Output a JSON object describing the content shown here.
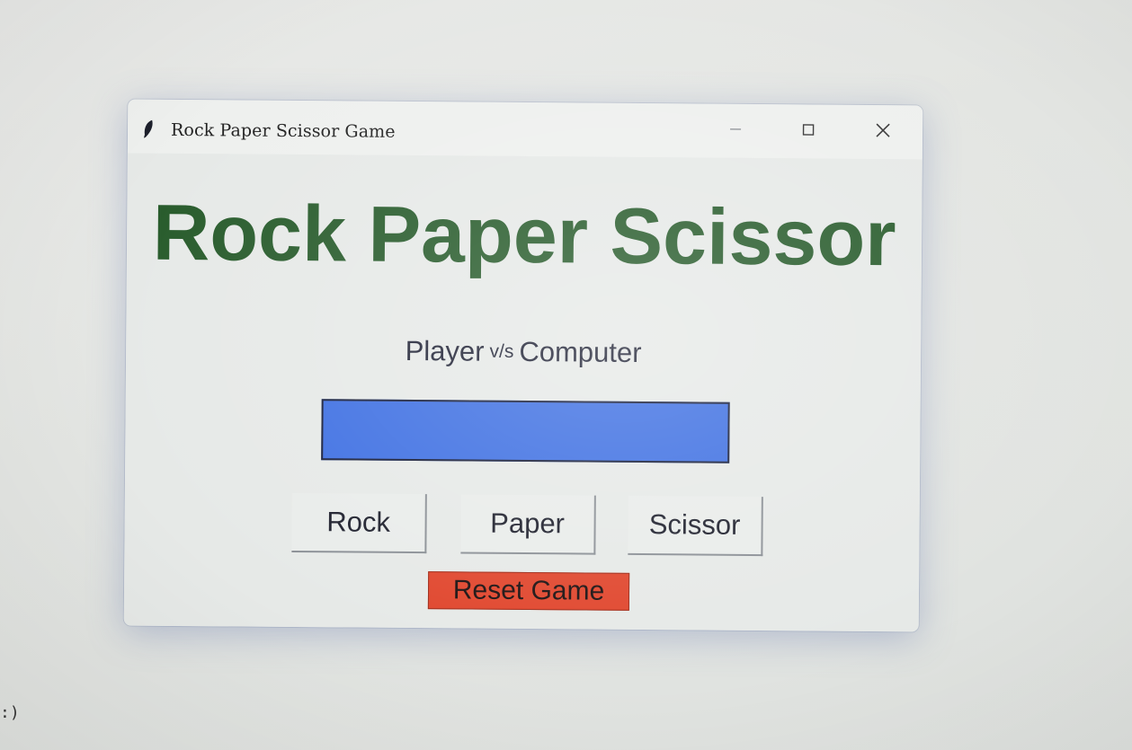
{
  "window": {
    "title": "Rock Paper Scissor Game",
    "icon": "feather-icon",
    "controls": {
      "minimize_icon": "minimize-icon",
      "maximize_icon": "maximize-icon",
      "close_icon": "close-icon"
    }
  },
  "game": {
    "heading": "Rock Paper Scissor",
    "subtitle_left": "Player",
    "subtitle_vs": "v/s",
    "subtitle_right": "Computer",
    "result_text": "",
    "result_color": "#3c6ee2",
    "buttons": {
      "rock": "Rock",
      "paper": "Paper",
      "scissor": "Scissor",
      "reset": "Reset Game"
    },
    "heading_color": "#265a2a",
    "reset_color": "#e0452c"
  },
  "background": {
    "stray_text": ":)"
  }
}
